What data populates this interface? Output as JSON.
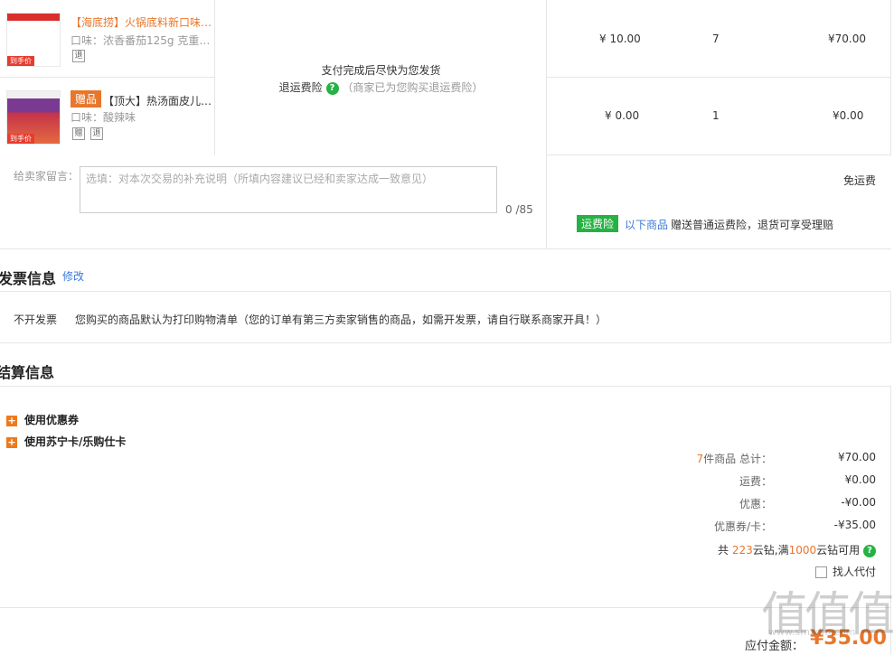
{
  "products": [
    {
      "title": "【海底捞】火锅底料新口味…",
      "attr": "口味：浓香番茄125g  克重…",
      "badges": [
        "退"
      ],
      "price": "¥ 10.00",
      "qty": "7",
      "subtotal": "¥70.00",
      "thumb_tag": "到手价"
    },
    {
      "gift_label": "赠品",
      "title": "【顶大】热汤面皮儿…",
      "attr": "口味：酸辣味",
      "badges": [
        "赠",
        "退"
      ],
      "price": "¥ 0.00",
      "qty": "1",
      "subtotal": "¥0.00",
      "thumb_tag": "到手价"
    }
  ],
  "shipping": {
    "line1": "支付完成后尽快为您发货",
    "insurance_label": "退运费险",
    "insurance_note": "（商家已为您购买退运费险）"
  },
  "message": {
    "label": "给卖家留言：",
    "placeholder": "选填：对本次交易的补充说明（所填内容建议已经和卖家达成一致意见）",
    "counter": "0 /85"
  },
  "freight": {
    "free_label": "免运费",
    "badge": "运费险",
    "link": "以下商品",
    "note": "赠送普通运费险，退货可享受理赔"
  },
  "invoice": {
    "title": "发票信息",
    "edit": "修改",
    "type": "不开发票",
    "note": "您购买的商品默认为打印购物清单（您的订单有第三方卖家销售的商品，如需开发票，请自行联系商家开具！）"
  },
  "settlement": {
    "title": "结算信息",
    "options": [
      "使用优惠券",
      "使用苏宁卡/乐购仕卡"
    ],
    "count_num": "7",
    "count_label": "件商品 总计：",
    "total": "¥70.00",
    "freight_label": "运费：",
    "freight_val": "¥0.00",
    "discount_label": "优惠：",
    "discount_val": "-¥0.00",
    "coupon_label": "优惠券/卡：",
    "coupon_val": "-¥35.00",
    "diamond_pre": "共 ",
    "diamond_num": "223",
    "diamond_mid": "云钻,满",
    "diamond_threshold": "1000",
    "diamond_post": "云钻可用",
    "proxy_pay": "找人代付",
    "payable_label": "应付金额：",
    "payable_val": "¥35.00"
  },
  "watermark": "值值值",
  "watermark_sub": "www.smzdm.com"
}
